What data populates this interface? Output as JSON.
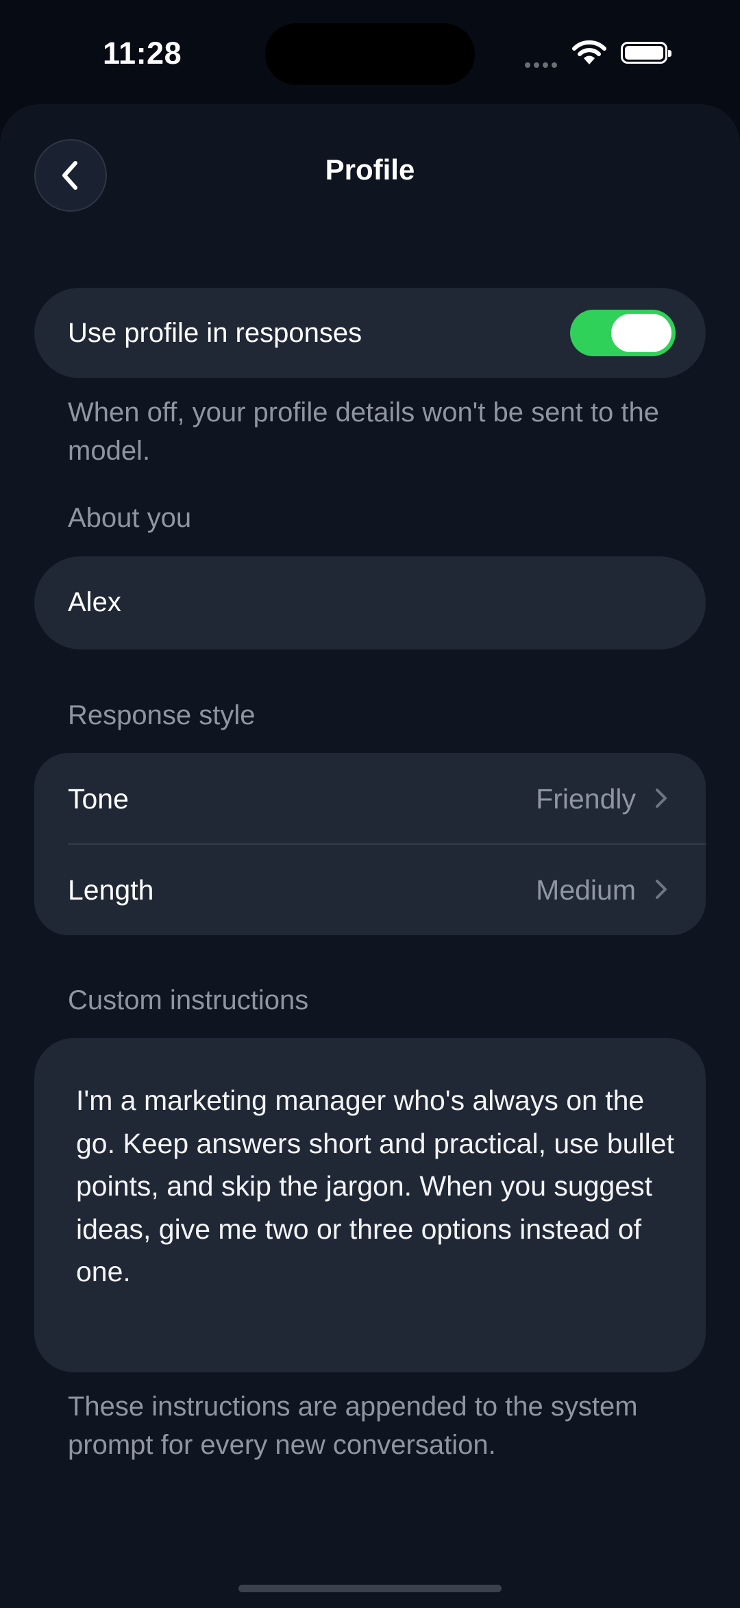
{
  "status_bar": {
    "time": "11:28"
  },
  "header": {
    "title": "Profile",
    "back_icon": "chevron-left-icon"
  },
  "toggle": {
    "label": "Use profile in responses",
    "on": true,
    "on_color": "#30d158"
  },
  "toggle_helper": "When off, your profile details won't be sent to the model.",
  "about": {
    "section_label": "About you",
    "name": "Alex"
  },
  "response_style": {
    "section_label": "Response style",
    "rows": [
      {
        "label": "Tone",
        "value": "Friendly"
      },
      {
        "label": "Length",
        "value": "Medium"
      }
    ]
  },
  "custom_instructions": {
    "section_label": "Custom instructions",
    "text": "I'm a marketing manager who's always on the go. Keep answers short and practical, use bullet points, and skip the jargon. When you suggest\nideas, give me two or three options instead of one.",
    "helper": "These instructions are appended to the system prompt for every new conversation."
  },
  "colors": {
    "background": "#070b13",
    "sheet": "#0e1420",
    "card": "#202836",
    "secondary_text": "#8f95a1"
  }
}
